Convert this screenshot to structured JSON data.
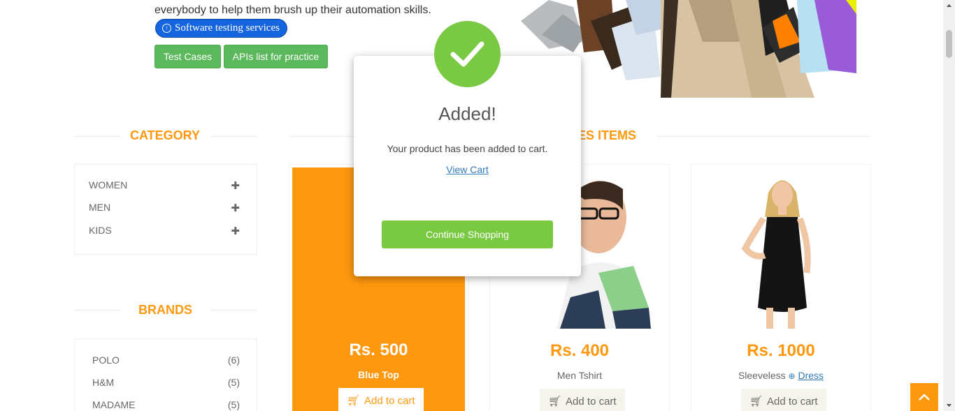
{
  "hero": {
    "text": "everybody to help them brush up their automation skills.",
    "service_pill": "Software testing services",
    "buttons": [
      "Test Cases",
      "APIs list for practice"
    ]
  },
  "sidebar": {
    "category_title": "CATEGORY",
    "categories": [
      "WOMEN",
      "MEN",
      "KIDS"
    ],
    "brands_title": "BRANDS",
    "brands": [
      {
        "name": "POLO",
        "count": "(6)"
      },
      {
        "name": "H&M",
        "count": "(5)"
      },
      {
        "name": "MADAME",
        "count": "(5)"
      }
    ]
  },
  "main": {
    "title": "ES ITEMS",
    "products": [
      {
        "price": "Rs. 500",
        "name": "Blue Top",
        "cta": "Add to cart"
      },
      {
        "price": "Rs. 400",
        "name": "Men Tshirt",
        "cta": "Add to cart"
      },
      {
        "price": "Rs. 1000",
        "name_prefix": "Sleeveless",
        "name_link": "Dress",
        "cta": "Add to cart"
      }
    ]
  },
  "modal": {
    "title": "Added!",
    "message": "Your product has been added to cart.",
    "view_cart": "View Cart",
    "continue": "Continue Shopping"
  },
  "colors": {
    "accent": "#fe980f",
    "success": "#7ac943",
    "green_btn": "#5cb85c",
    "pill": "#1565e0"
  },
  "icons": [
    "check-icon",
    "plus-icon",
    "cart-icon",
    "chevron-up-icon",
    "circle-arrow-icon"
  ]
}
